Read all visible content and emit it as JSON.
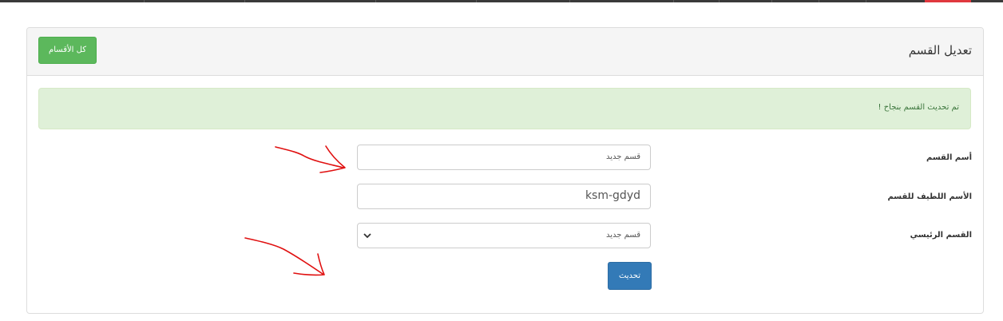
{
  "panel": {
    "title": "تعديل القسم",
    "all_sections_button": "كل الأقسام"
  },
  "alert": {
    "message": "تم تحديث القسم بنجاح !"
  },
  "form": {
    "name_label": "أسم القسم",
    "name_value": "قسم جديد",
    "slug_label": "الأسم اللطيف للقسم",
    "slug_value": "ksm-gdyd",
    "parent_label": "القسم الرئيسي",
    "parent_selected": "قسم جديد",
    "submit_label": "تحديث"
  },
  "colors": {
    "success_button": "#5cb85c",
    "primary_button": "#337ab7",
    "alert_bg": "#dff0d8",
    "annotation": "#e01010"
  }
}
